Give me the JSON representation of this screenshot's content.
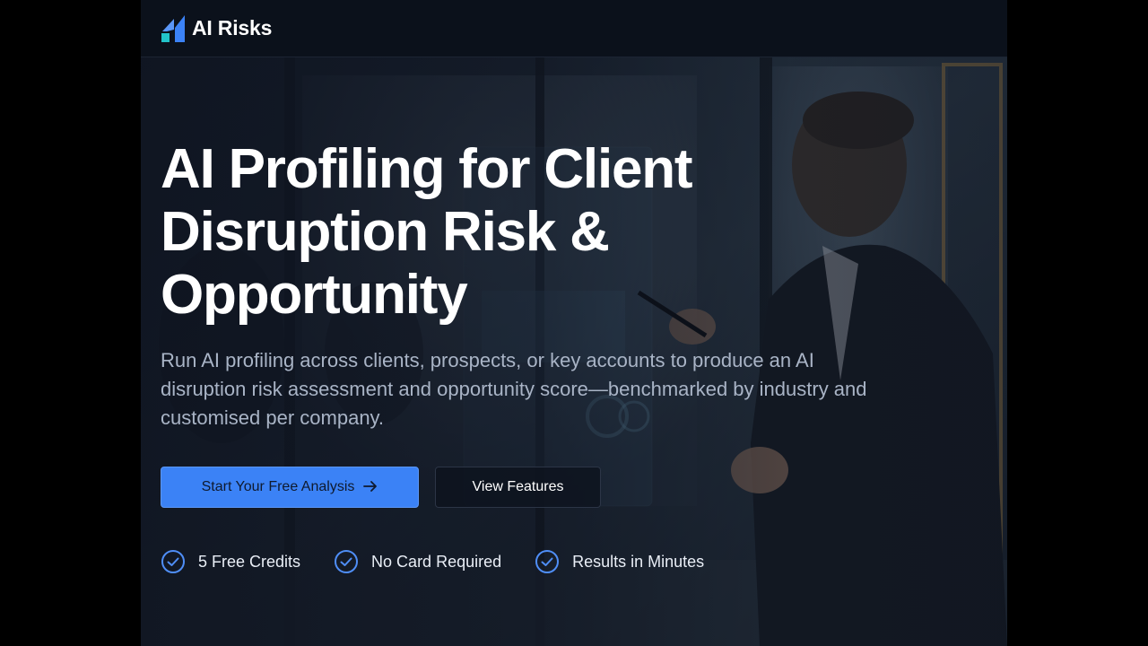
{
  "header": {
    "logo_text": "AI Risks",
    "logo_icon": "ai-risks-logo-icon"
  },
  "hero": {
    "headline_line1": "AI Profiling for Client",
    "headline_line2": "Disruption Risk &",
    "headline_line3": "Opportunity",
    "subtext": "Run AI profiling across clients, prospects, or key accounts to produce an AI disruption risk assessment and opportunity score—benchmarked by industry and customised per company.",
    "background_image": "businessman-presenting-dashboard-photo"
  },
  "actions": {
    "primary_label": "Start Your Free Analysis",
    "primary_icon": "arrow-right-icon",
    "secondary_label": "View Features"
  },
  "features": [
    {
      "label": "5 Free Credits",
      "icon": "check-circle-icon"
    },
    {
      "label": "No Card Required",
      "icon": "check-circle-icon"
    },
    {
      "label": "Results in Minutes",
      "icon": "check-circle-icon"
    }
  ],
  "colors": {
    "accent": "#3b82f6",
    "background": "#0d131f",
    "headline": "#ffffff",
    "subtext": "#a9b4c6",
    "check": "#4f8ef7"
  }
}
